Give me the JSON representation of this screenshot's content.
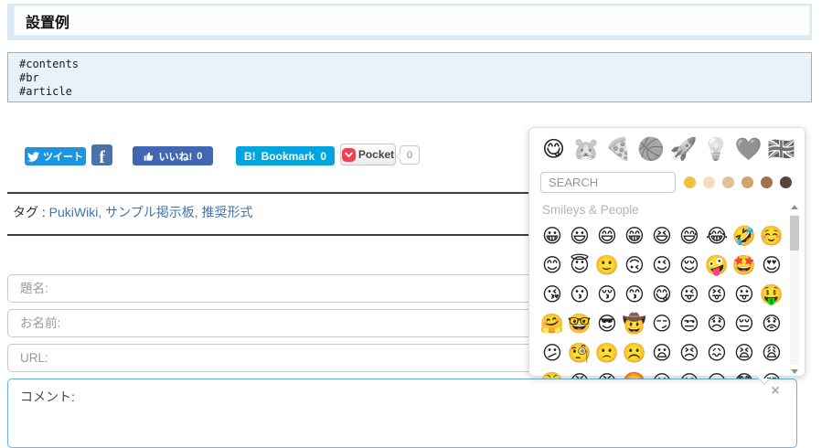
{
  "header": {
    "title": "設置例"
  },
  "code_block": {
    "lines": [
      "#contents",
      "#br",
      "#article"
    ]
  },
  "share": {
    "tweet": {
      "label": "ツイート"
    },
    "facebook": {
      "label": "f"
    },
    "like": {
      "label": "いいね!",
      "count": "0"
    },
    "hatena": {
      "prefix": "B!",
      "label": "Bookmark",
      "count": "0"
    },
    "pocket": {
      "label": "Pocket",
      "count": "0"
    }
  },
  "tags": {
    "label": "タグ :",
    "separator": ", ",
    "items": [
      "PukiWiki",
      "サンプル掲示板",
      "推奨形式"
    ]
  },
  "form": {
    "subject_placeholder": "題名:",
    "name_placeholder": "お名前:",
    "url_placeholder": "URL:",
    "comment_placeholder": "コメント:",
    "close_label": "×"
  },
  "emoji_picker": {
    "categories": [
      {
        "name": "smileys-people",
        "glyph": "😋",
        "active": true
      },
      {
        "name": "animals-nature",
        "glyph": "🐹",
        "active": false
      },
      {
        "name": "food-drink",
        "glyph": "🍕",
        "active": false
      },
      {
        "name": "activity",
        "glyph": "🏀",
        "active": false
      },
      {
        "name": "travel-places",
        "glyph": "🚀",
        "active": false
      },
      {
        "name": "objects",
        "glyph": "💡",
        "active": false
      },
      {
        "name": "symbols",
        "glyph": "❤️",
        "active": false
      },
      {
        "name": "flags",
        "glyph": "🇬🇧",
        "active": false
      }
    ],
    "search_placeholder": "SEARCH",
    "skin_tones": [
      "#f0c23c",
      "#f6dcbd",
      "#e2bf9b",
      "#d3a16c",
      "#a3714b",
      "#57453c"
    ],
    "section_title": "Smileys & People",
    "emojis": [
      "😀",
      "😃",
      "😄",
      "😁",
      "😆",
      "😅",
      "😂",
      "🤣",
      "☺️",
      "😊",
      "😇",
      "🙂",
      "🙃",
      "😉",
      "😌",
      "🤪",
      "🤩",
      "😍",
      "😘",
      "😗",
      "😚",
      "😙",
      "😋",
      "😜",
      "😝",
      "😛",
      "🤑",
      "🤗",
      "🤓",
      "😎",
      "🤠",
      "😏",
      "😒",
      "😞",
      "😔",
      "😟",
      "😕",
      "🧐",
      "🙁",
      "☹️",
      "😦",
      "😣",
      "😖",
      "😫",
      "😩",
      "😤",
      "😠",
      "😡",
      "🤬",
      "😶",
      "😐",
      "😑",
      "😳",
      "😵"
    ]
  }
}
